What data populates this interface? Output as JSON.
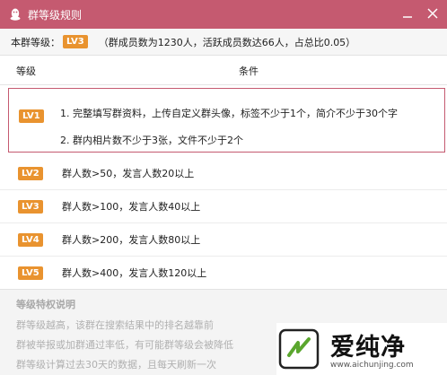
{
  "window": {
    "title": "群等级规则",
    "accent": "#c55a70"
  },
  "summary": {
    "label": "本群等级：",
    "level": "LV3",
    "stats": "（群成员数为1230人，活跃成员数达66人，占总比0.05）"
  },
  "table": {
    "headers": {
      "level": "等级",
      "condition": "条件"
    },
    "rows": [
      {
        "level": "LV1",
        "lines": [
          "1. 完整填写群资料，上传自定义群头像，标签不少于1个，简介不少于30个字",
          "2. 群内相片数不少于3张，文件不少于2个"
        ]
      },
      {
        "level": "LV2",
        "text": "群人数>50，发言人数20以上"
      },
      {
        "level": "LV3",
        "text": "群人数>100，发言人数40以上"
      },
      {
        "level": "LV4",
        "text": "群人数>200，发言人数80以上"
      },
      {
        "level": "LV5",
        "text": "群人数>400，发言人数120以上"
      }
    ]
  },
  "privileges": {
    "title": "等级特权说明",
    "lines": [
      "群等级越高，该群在搜索结果中的排名越靠前",
      "群被举报或加群通过率低，有可能群等级会被降低",
      "群等级计算过去30天的数据，且每天刷新一次"
    ]
  },
  "watermark": {
    "brand": "爱纯净",
    "url": "www.aichunjing.com"
  }
}
